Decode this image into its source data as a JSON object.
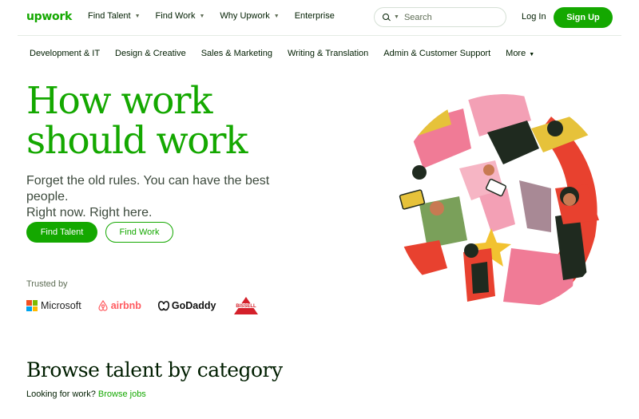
{
  "logo": "upwork",
  "nav": {
    "links": [
      {
        "label": "Find Talent",
        "has_dropdown": true
      },
      {
        "label": "Find Work",
        "has_dropdown": true
      },
      {
        "label": "Why Upwork",
        "has_dropdown": true
      },
      {
        "label": "Enterprise",
        "has_dropdown": false
      }
    ],
    "search_placeholder": "Search",
    "login": "Log In",
    "signup": "Sign Up"
  },
  "categories": [
    "Development & IT",
    "Design & Creative",
    "Sales & Marketing",
    "Writing & Translation",
    "Admin & Customer Support"
  ],
  "categories_more": "More",
  "hero": {
    "title_line1": "How work",
    "title_line2": "should work",
    "subtitle_line1": "Forget the old rules. You can have the best people.",
    "subtitle_line2": "Right now. Right here.",
    "find_talent": "Find Talent",
    "find_work": "Find Work"
  },
  "trusted": {
    "label": "Trusted by",
    "brands": [
      "Microsoft",
      "airbnb",
      "GoDaddy",
      "BISSELL"
    ]
  },
  "browse": {
    "title": "Browse talent by category",
    "prompt": "Looking for work?",
    "link": "Browse jobs"
  },
  "colors": {
    "brand_green": "#14a800",
    "text_dark": "#001e00",
    "ms_red": "#f25022",
    "ms_green": "#7fba00",
    "ms_blue": "#00a4ef",
    "ms_yellow": "#ffb900",
    "airbnb": "#ff5a5f",
    "bissell_red": "#d4202a"
  }
}
